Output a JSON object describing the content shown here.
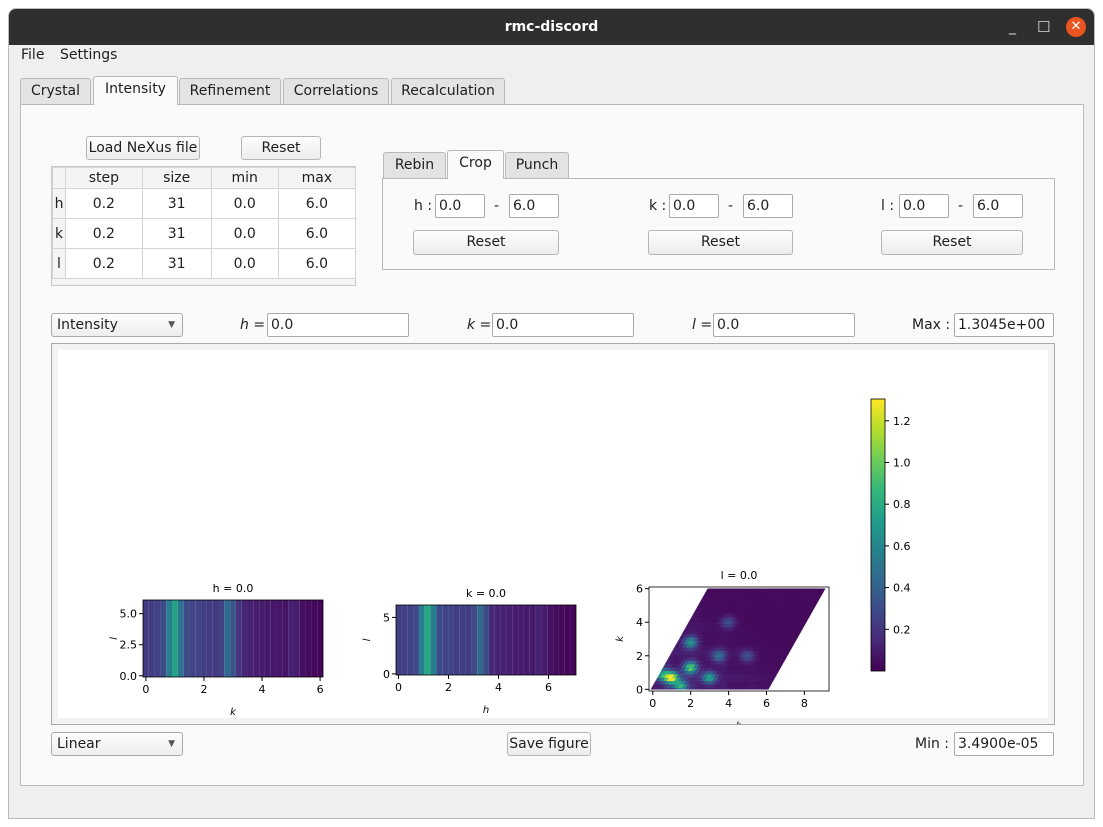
{
  "window": {
    "title": "rmc-discord",
    "minimize": "_",
    "maximize": "☐",
    "close": "✕"
  },
  "menu": [
    "File",
    "Settings"
  ],
  "tabs": [
    {
      "label": "Crystal"
    },
    {
      "label": "Intensity",
      "active": true
    },
    {
      "label": "Refinement"
    },
    {
      "label": "Correlations"
    },
    {
      "label": "Recalculation"
    }
  ],
  "load_button": "Load NeXus file",
  "reset_button": "Reset",
  "binning_table": {
    "headers": [
      "step",
      "size",
      "min",
      "max"
    ],
    "rows": [
      {
        "axis": "h",
        "values": [
          "0.2",
          "31",
          "0.0",
          "6.0"
        ]
      },
      {
        "axis": "k",
        "values": [
          "0.2",
          "31",
          "0.0",
          "6.0"
        ]
      },
      {
        "axis": "l",
        "values": [
          "0.2",
          "31",
          "0.0",
          "6.0"
        ]
      }
    ]
  },
  "subtabs": [
    {
      "label": "Rebin"
    },
    {
      "label": "Crop",
      "active": true
    },
    {
      "label": "Punch"
    }
  ],
  "crop": {
    "h": {
      "label": "h :",
      "min": "0.0",
      "max": "6.0",
      "reset": "Reset"
    },
    "k": {
      "label": "k :",
      "min": "0.0",
      "max": "6.0",
      "reset": "Reset"
    },
    "l": {
      "label": "l :",
      "min": "0.0",
      "max": "6.0",
      "reset": "Reset"
    },
    "dash": "-"
  },
  "slice": {
    "mode": "Intensity",
    "h_label": "h =",
    "h": "0.0",
    "k_label": "k =",
    "k": "0.0",
    "l_label": "l =",
    "l": "0.0",
    "max_label": "Max :",
    "max": "1.3045e+00"
  },
  "bottom": {
    "scale": "Linear",
    "save": "Save figure",
    "min_label": "Min :",
    "min": "3.4900e-05"
  },
  "colors": {
    "titlebar": "#2f2f2f",
    "close": "#e95420",
    "colormap": "viridis"
  },
  "chart_data": [
    {
      "type": "heatmap",
      "title": "h = 0.0",
      "xlabel": "k",
      "ylabel": "l",
      "xlim": [
        0,
        6
      ],
      "ylim": [
        0,
        6
      ],
      "xticks": [
        "0",
        "2",
        "4",
        "6"
      ],
      "yticks": [
        "0.0",
        "2.5",
        "5.0"
      ],
      "column_values": [
        0.22,
        0.24,
        0.25,
        0.3,
        0.55,
        0.75,
        0.5,
        0.3,
        0.27,
        0.26,
        0.24,
        0.22,
        0.22,
        0.25,
        0.45,
        0.35,
        0.2,
        0.13,
        0.12,
        0.11,
        0.1,
        0.09,
        0.08,
        0.08,
        0.07,
        0.12,
        0.1,
        0.05,
        0.04,
        0.03,
        0.02
      ]
    },
    {
      "type": "heatmap",
      "title": "k = 0.0",
      "xlabel": "h",
      "ylabel": "l",
      "xlim": [
        0,
        7
      ],
      "ylim": [
        0,
        6
      ],
      "xticks": [
        "0",
        "2",
        "4",
        "6"
      ],
      "yticks": [
        "0",
        "5"
      ],
      "column_values": [
        0.24,
        0.25,
        0.26,
        0.28,
        0.55,
        0.78,
        0.55,
        0.3,
        0.27,
        0.26,
        0.24,
        0.24,
        0.23,
        0.3,
        0.45,
        0.3,
        0.15,
        0.13,
        0.12,
        0.11,
        0.1,
        0.1,
        0.09,
        0.09,
        0.12,
        0.1,
        0.06,
        0.04,
        0.03,
        0.02,
        0.02
      ]
    },
    {
      "type": "heatmap",
      "title": "l = 0.0",
      "xlabel": "h",
      "ylabel": "k",
      "xlim": [
        0,
        9
      ],
      "ylim": [
        0,
        6
      ],
      "xticks": [
        "0",
        "2",
        "4",
        "6",
        "8"
      ],
      "yticks": [
        "0",
        "2",
        "4",
        "6"
      ],
      "peaks": [
        {
          "h": 1,
          "k": 0.7,
          "v": 1.25
        },
        {
          "h": 2,
          "k": 1.3,
          "v": 0.95
        },
        {
          "h": 1.5,
          "k": 0.2,
          "v": 0.8
        },
        {
          "h": 3,
          "k": 0.7,
          "v": 0.7
        },
        {
          "h": 2,
          "k": 2.8,
          "v": 0.65
        },
        {
          "h": 0.5,
          "k": 0.9,
          "v": 0.6
        },
        {
          "h": 3.5,
          "k": 2,
          "v": 0.45
        },
        {
          "h": 5,
          "k": 2,
          "v": 0.3
        },
        {
          "h": 4,
          "k": 4,
          "v": 0.3
        }
      ]
    },
    {
      "type": "colorbar",
      "ticks": [
        "0.2",
        "0.4",
        "0.6",
        "0.8",
        "1.0",
        "1.2"
      ],
      "range": [
        3.49e-05,
        1.3045
      ]
    }
  ]
}
